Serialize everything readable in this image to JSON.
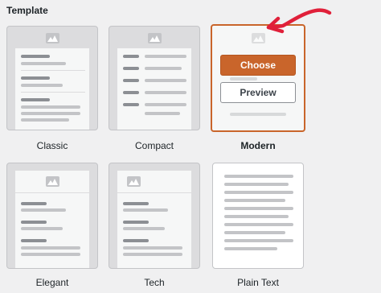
{
  "section_title": "Template",
  "templates": [
    {
      "name": "Classic"
    },
    {
      "name": "Compact"
    },
    {
      "name": "Modern",
      "selected": true
    },
    {
      "name": "Elegant"
    },
    {
      "name": "Tech"
    },
    {
      "name": "Plain Text"
    }
  ],
  "actions": {
    "choose_label": "Choose",
    "preview_label": "Preview"
  },
  "icons": {
    "thumbnail": "image-placeholder-icon",
    "annotation": "curved-arrow-icon"
  },
  "colors": {
    "accent": "#c9652b",
    "arrow": "#e0203a",
    "background": "#f0f0f1"
  }
}
